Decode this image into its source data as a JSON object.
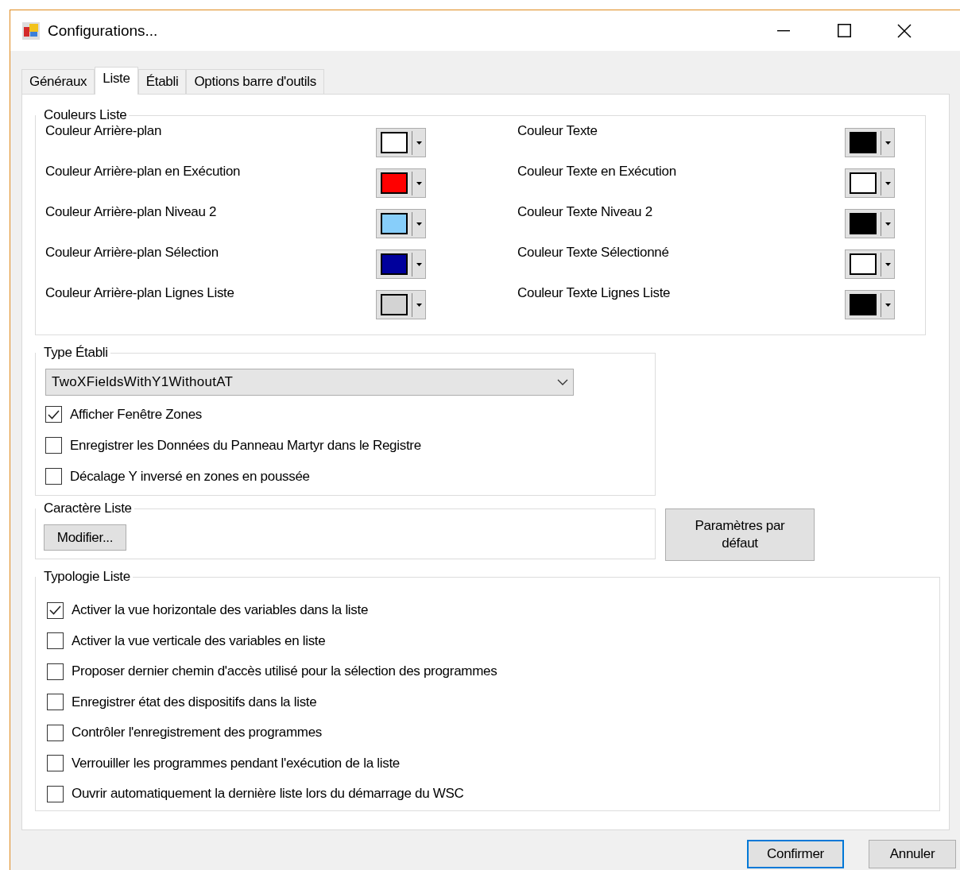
{
  "window": {
    "title": "Configurations..."
  },
  "tabs": [
    {
      "label": "Généraux",
      "selected": false
    },
    {
      "label": "Liste",
      "selected": true
    },
    {
      "label": "Établi",
      "selected": false
    },
    {
      "label": "Options barre d'outils",
      "selected": false
    }
  ],
  "colors_group": {
    "title": "Couleurs Liste",
    "left": [
      {
        "label": "Couleur Arrière-plan",
        "color": "#ffffff"
      },
      {
        "label": "Couleur Arrière-plan en Exécution",
        "color": "#ff0000"
      },
      {
        "label": "Couleur Arrière-plan Niveau 2",
        "color": "#87cefa"
      },
      {
        "label": "Couleur Arrière-plan Sélection",
        "color": "#00009c"
      },
      {
        "label": "Couleur Arrière-plan Lignes Liste",
        "color": "#d3d3d3"
      }
    ],
    "right": [
      {
        "label": "Couleur Texte",
        "color": "#000000"
      },
      {
        "label": "Couleur Texte en Exécution",
        "color": "#ffffff"
      },
      {
        "label": "Couleur Texte Niveau 2",
        "color": "#000000"
      },
      {
        "label": "Couleur Texte Sélectionné",
        "color": "#ffffff"
      },
      {
        "label": "Couleur Texte Lignes Liste",
        "color": "#000000"
      }
    ]
  },
  "type_group": {
    "title": "Type Établi",
    "dropdown": {
      "value": "TwoXFieldsWithY1WithoutAT"
    },
    "options": [
      {
        "label": "Afficher Fenêtre Zones",
        "checked": true
      },
      {
        "label": "Enregistrer les Données du Panneau Martyr dans le Registre",
        "checked": false
      },
      {
        "label": "Décalage Y inversé en zones en poussée",
        "checked": false
      }
    ]
  },
  "font_group": {
    "title": "Caractère Liste",
    "button": "Modifier..."
  },
  "defaults_button": "Paramètres par défaut",
  "typology_group": {
    "title": "Typologie Liste",
    "options": [
      {
        "label": "Activer la vue horizontale des variables dans la liste",
        "checked": true
      },
      {
        "label": "Activer la vue verticale des variables en liste",
        "checked": false
      },
      {
        "label": "Proposer dernier chemin d'accès utilisé pour la sélection des programmes",
        "checked": false
      },
      {
        "label": "Enregistrer état des dispositifs dans la liste",
        "checked": false
      },
      {
        "label": "Contrôler l'enregistrement des programmes",
        "checked": false
      },
      {
        "label": "Verrouiller les programmes pendant l'exécution de la liste",
        "checked": false
      },
      {
        "label": "Ouvrir automatiquement la dernière liste lors du démarrage du WSC",
        "checked": false
      }
    ]
  },
  "buttons": [
    {
      "label": "Confirmer",
      "default": true
    },
    {
      "label": "Annuler",
      "default": false
    }
  ]
}
